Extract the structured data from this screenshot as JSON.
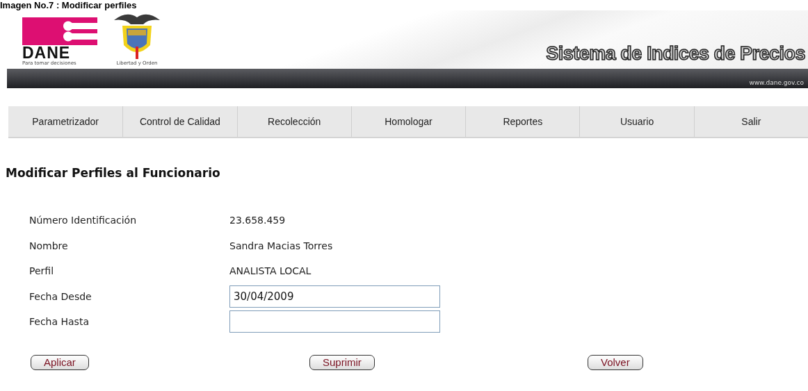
{
  "caption": "Imagen No.7 : Modificar perfiles",
  "header": {
    "logo_text": "DANE",
    "logo_tagline": "Para tomar decisiones",
    "emblem_motto": "Libertad y Orden",
    "system_title": "Sistema de Indices de Precios",
    "website": "www.dane.gov.co"
  },
  "menu": [
    {
      "label": "Parametrizador"
    },
    {
      "label": "Control de Calidad"
    },
    {
      "label": "Recolección"
    },
    {
      "label": "Homologar"
    },
    {
      "label": "Reportes"
    },
    {
      "label": "Usuario"
    },
    {
      "label": "Salir"
    }
  ],
  "page_title": "Modificar Perfiles al Funcionario",
  "fields": [
    {
      "kind": "text",
      "label": "Número Identificación",
      "value": "23.658.459"
    },
    {
      "kind": "text",
      "label": "Nombre",
      "value": "Sandra Macias Torres"
    },
    {
      "kind": "text",
      "label": "Perfil",
      "value": "ANALISTA LOCAL"
    },
    {
      "kind": "input",
      "label": "Fecha Desde",
      "value": "30/04/2009"
    },
    {
      "kind": "input",
      "label": "Fecha Hasta"
    }
  ],
  "buttons": [
    "Aplicar",
    "Suprimir",
    "Volver"
  ]
}
